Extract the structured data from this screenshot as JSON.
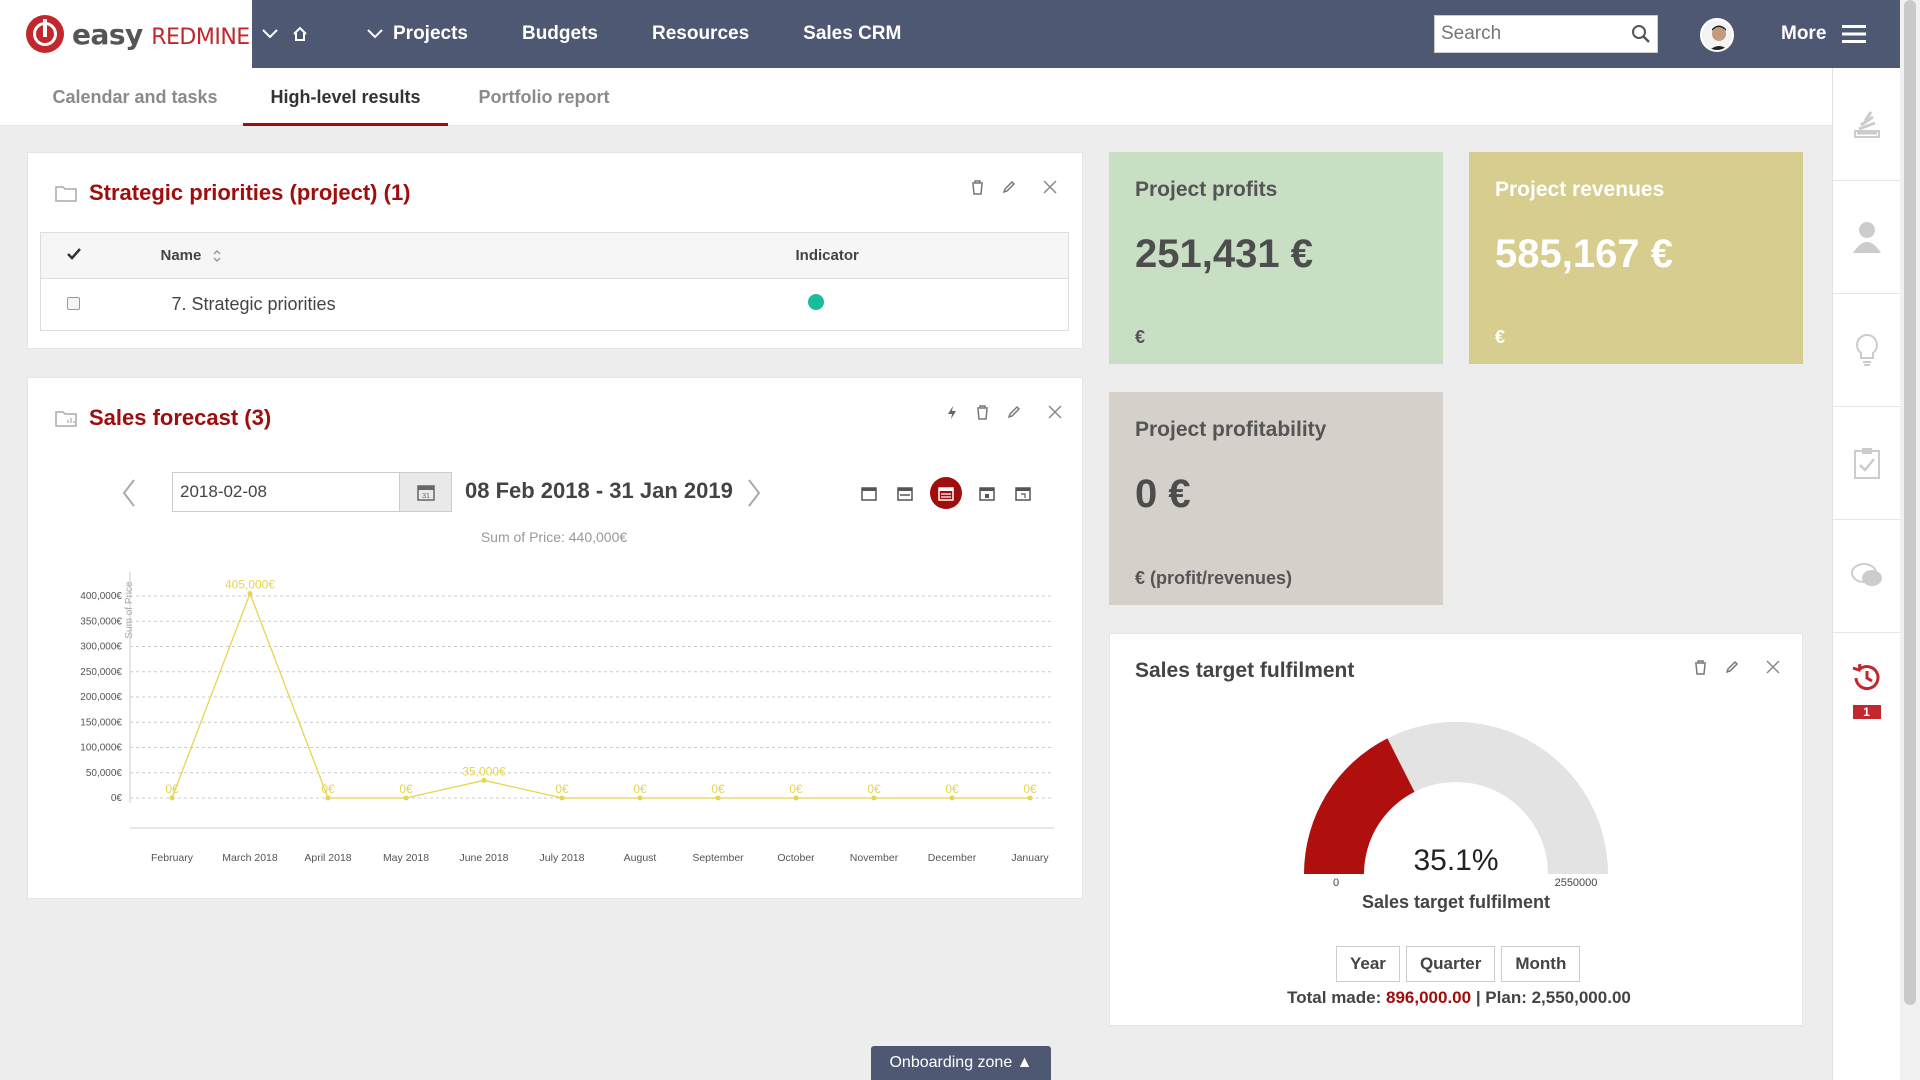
{
  "topbar": {
    "logo_easy": "easy",
    "logo_redmine": "REDMINE",
    "nav": [
      "Projects",
      "Budgets",
      "Resources",
      "Sales CRM"
    ],
    "search_placeholder": "Search",
    "more_label": "More"
  },
  "tabs": [
    "Calendar and tasks",
    "High-level results",
    "Portfolio report"
  ],
  "strategic": {
    "title": "Strategic priorities (project) (1)",
    "col_name": "Name",
    "col_indicator": "Indicator",
    "rows": [
      {
        "name": "7. Strategic priorities",
        "indicator_color": "#1abc9c"
      }
    ]
  },
  "kpis": {
    "profits": {
      "title": "Project profits",
      "value": "251,431 €",
      "unit": "€",
      "bg": "#c8dfc4"
    },
    "revenues": {
      "title": "Project revenues",
      "value": "585,167 €",
      "unit": "€",
      "bg": "#d6cd8e"
    },
    "profitability": {
      "title": "Project profitability",
      "value": "0 €",
      "unit": "€ (profit/revenues)",
      "bg": "#d6d0ca"
    }
  },
  "forecast": {
    "title": "Sales forecast (3)",
    "date_value": "2018-02-08",
    "period": "08 Feb 2018 - 31 Jan 2019",
    "calendar_day": "31"
  },
  "chart_data": {
    "type": "line",
    "title": "Sum of Price: 440,000€",
    "ylabel": "Sum of Price",
    "xlabel": "",
    "categories": [
      "February",
      "March 2018",
      "April 2018",
      "May 2018",
      "June 2018",
      "July 2018",
      "August",
      "September",
      "October",
      "November",
      "December",
      "January"
    ],
    "series": [
      {
        "name": "Sum of Price",
        "values": [
          0,
          405000,
          0,
          0,
          35000,
          0,
          0,
          0,
          0,
          0,
          0,
          0
        ],
        "labels": [
          "0€",
          "405,000€",
          "0€",
          "0€",
          "35,000€",
          "0€",
          "0€",
          "0€",
          "0€",
          "0€",
          "0€",
          "0€"
        ],
        "color": "#e8d44d"
      }
    ],
    "yticks": [
      "0€",
      "50,000€",
      "100,000€",
      "150,000€",
      "200,000€",
      "250,000€",
      "300,000€",
      "350,000€",
      "400,000€"
    ],
    "ylim": [
      0,
      400000
    ],
    "grid": true,
    "legend": "bottom"
  },
  "gauge": {
    "title": "Sales target fulfilment",
    "percent_label": "35.1%",
    "fraction": 0.351,
    "min_label": "0",
    "max_label": "2550000",
    "caption": "Sales target fulfilment",
    "buttons": [
      "Year",
      "Quarter",
      "Month"
    ],
    "total_made_label": "Total made:",
    "total_made_value": "896,000.00",
    "plan_label": "| Plan: 2,550,000.00",
    "fill_color": "#b0100d",
    "track_color": "#e3e3e3"
  },
  "rightbar": {
    "badge": "1"
  },
  "onboarding": "Onboarding zone ▲"
}
